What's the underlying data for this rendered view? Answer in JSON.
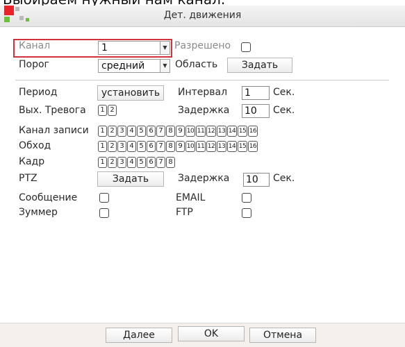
{
  "caption": "Выбираем нужный нам канал.",
  "window": {
    "title": "Дет. движения"
  },
  "colors": {
    "highlight": "#d0333a",
    "logo_red": "#e8232a",
    "logo_green": "#6bbf3a",
    "logo_grey": "#b9b9b9"
  },
  "form": {
    "channel": {
      "label": "Канал",
      "value": "1"
    },
    "enabled_label": "Разрешено",
    "threshold": {
      "label": "Порог",
      "value": "средний"
    },
    "area": {
      "label": "Область",
      "button": "Задать"
    },
    "period": {
      "label": "Период",
      "button": "установить"
    },
    "interval": {
      "label": "Интервал",
      "value": "1",
      "unit": "Сек."
    },
    "alarm_out": {
      "label": "Вых. Тревога",
      "channels": [
        "1",
        "2"
      ]
    },
    "delay": {
      "label": "Задержка",
      "value": "10",
      "unit": "Сек."
    },
    "record_channel": {
      "label": "Канал записи",
      "channels": [
        "1",
        "2",
        "3",
        "4",
        "5",
        "6",
        "7",
        "8",
        "9",
        "10",
        "11",
        "12",
        "13",
        "14",
        "15",
        "16"
      ]
    },
    "tour": {
      "label": "Обход",
      "channels": [
        "1",
        "2",
        "3",
        "4",
        "5",
        "6",
        "7",
        "8",
        "9",
        "10",
        "11",
        "12",
        "13",
        "14",
        "15",
        "16"
      ]
    },
    "snapshot": {
      "label": "Кадр",
      "channels": [
        "1",
        "2",
        "3",
        "4",
        "5",
        "6",
        "7",
        "8"
      ]
    },
    "ptz": {
      "label": "PTZ",
      "button": "Задать"
    },
    "ptz_delay": {
      "label": "Задержка",
      "value": "10",
      "unit": "Сек."
    },
    "message_label": "Сообщение",
    "email_label": "EMAIL",
    "buzzer_label": "Зуммер",
    "ftp_label": "FTP"
  },
  "footer": {
    "next": "Далее",
    "ok": "OK",
    "cancel": "Отмена"
  }
}
